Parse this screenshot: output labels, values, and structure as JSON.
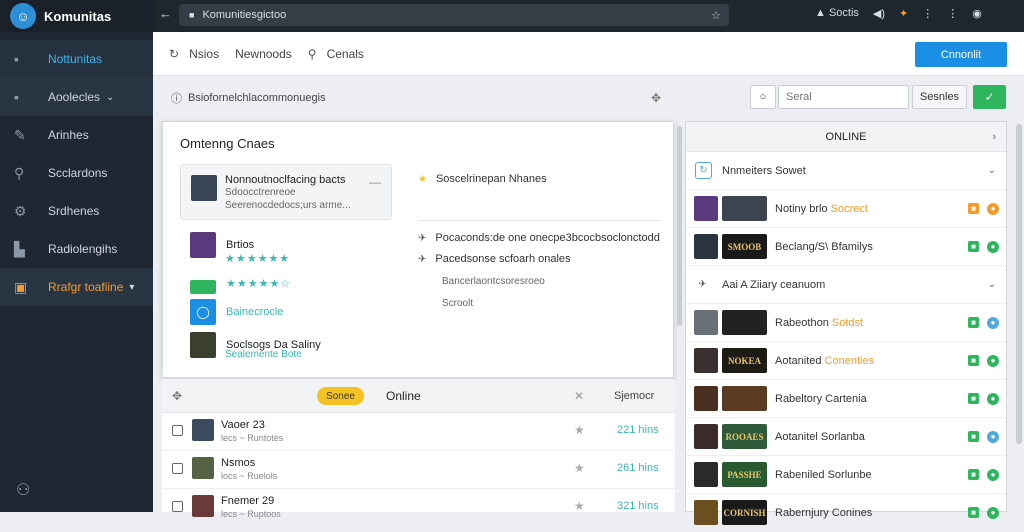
{
  "app": {
    "name": "Komunitas"
  },
  "sidebar": {
    "items": [
      {
        "label": "Nottunitas",
        "icon": "square-icon"
      },
      {
        "label": "Aoolecles",
        "icon": "square-icon"
      },
      {
        "label": "Arinhes",
        "icon": "pin-icon"
      },
      {
        "label": "Scclardons",
        "icon": "search-icon"
      },
      {
        "label": "Srdhenes",
        "icon": "gear-icon"
      },
      {
        "label": "Radiolengihs",
        "icon": "door-icon"
      },
      {
        "label": "Rrafgr toafiine",
        "icon": "folder-icon"
      }
    ]
  },
  "browser": {
    "url": "Komunitiesgictoo",
    "right_items": [
      "Soctis",
      "⋮",
      "⋮"
    ]
  },
  "toolbar": {
    "items": [
      {
        "label": "Nsios",
        "icon": "refresh-icon"
      },
      {
        "label": "Newnoods",
        "icon": ""
      },
      {
        "label": "Cenals",
        "icon": "search-icon"
      }
    ],
    "primary_button": "Cnnonlit"
  },
  "pathbar": {
    "path": "Bsiofornelchlacommonuegis",
    "search_placeholder": "Seral",
    "search_button": "Sesnles"
  },
  "popup": {
    "title": "Omtenng Cnaes",
    "card": {
      "line1": "Nonnoutnoclfacing bacts",
      "line2": "Sdoocctrenreoe",
      "line3": "Seerenocdedocs;urs arme..."
    },
    "items": [
      {
        "name": "Brtios",
        "stars": "★★★★★★",
        "color": "#5a3a7c"
      },
      {
        "name": "",
        "stars": "★★★★★☆",
        "color": "#2fb55d"
      },
      {
        "name": "Bainecrocle",
        "color": "#1a8fe3"
      },
      {
        "name": "Soclsogs Da Saliny",
        "sub": "Sealemente Bote",
        "color": "#3a3f2e"
      }
    ],
    "right": [
      "Soscelrinepan Nhanes",
      "Pocaconds:de one onecpe3bcocbsoclonctodd",
      "Pacedsonse scfoarh onales",
      "Bancerlaontcsoresroeo",
      "Scroolt"
    ]
  },
  "list": {
    "header": {
      "badge": "Sonee",
      "label": "Online",
      "size_label": "Sjemocr"
    },
    "rows": [
      {
        "name": "Vaoer 23",
        "sub": "lecs ~ Runtotes",
        "value": "221 hins"
      },
      {
        "name": "Nsmos",
        "sub": "locs ~ Ruelols",
        "value": "261 hins"
      },
      {
        "name": "Fnemer 29",
        "sub": "lecs ~ Ruptoos",
        "value": "321 hins"
      }
    ]
  },
  "right_panel": {
    "header": "ONLINE",
    "section1": "Nnmeiters Sowet",
    "section2": "Aai A Ziiary ceanuom",
    "rows": [
      {
        "name": "Notiny brlo",
        "accent": "Socrect",
        "thumb": "",
        "i1": "#f39c2b",
        "i2": "#f39c2b"
      },
      {
        "name": "Beclang/S\\ Bfamilys",
        "accent": "",
        "thumb": "SMOOB",
        "i1": "#2fb55d",
        "i2": "#2fb55d"
      },
      {
        "name": "Rabeothon",
        "accent": "Sotdst",
        "thumb": "",
        "i1": "#2fb55d",
        "i2": "#52a8d8"
      },
      {
        "name": "Aotanited",
        "accent": "Conenties",
        "thumb": "NOKEA",
        "i1": "#2fb55d",
        "i2": "#2fb55d"
      },
      {
        "name": "Rabeltory Cartenia",
        "accent": "",
        "thumb": "",
        "i1": "#2fb55d",
        "i2": "#2fb55d"
      },
      {
        "name": "Aotanitel Sorlanba",
        "accent": "",
        "thumb": "ROOAES",
        "i1": "#2fb55d",
        "i2": "#52a8d8"
      },
      {
        "name": "Rabeniled Sorlunbe",
        "accent": "",
        "thumb": "PASSHE",
        "i1": "#2fb55d",
        "i2": "#2fb55d"
      },
      {
        "name": "Rabernjury Conines",
        "accent": "",
        "thumb": "CORNISH",
        "i1": "#2fb55d",
        "i2": "#2fb55d"
      }
    ]
  },
  "colors": {
    "accent": "#1a8fe3",
    "green": "#2fb55d",
    "orange": "#f39c2b",
    "teal": "#3ab7b0"
  }
}
